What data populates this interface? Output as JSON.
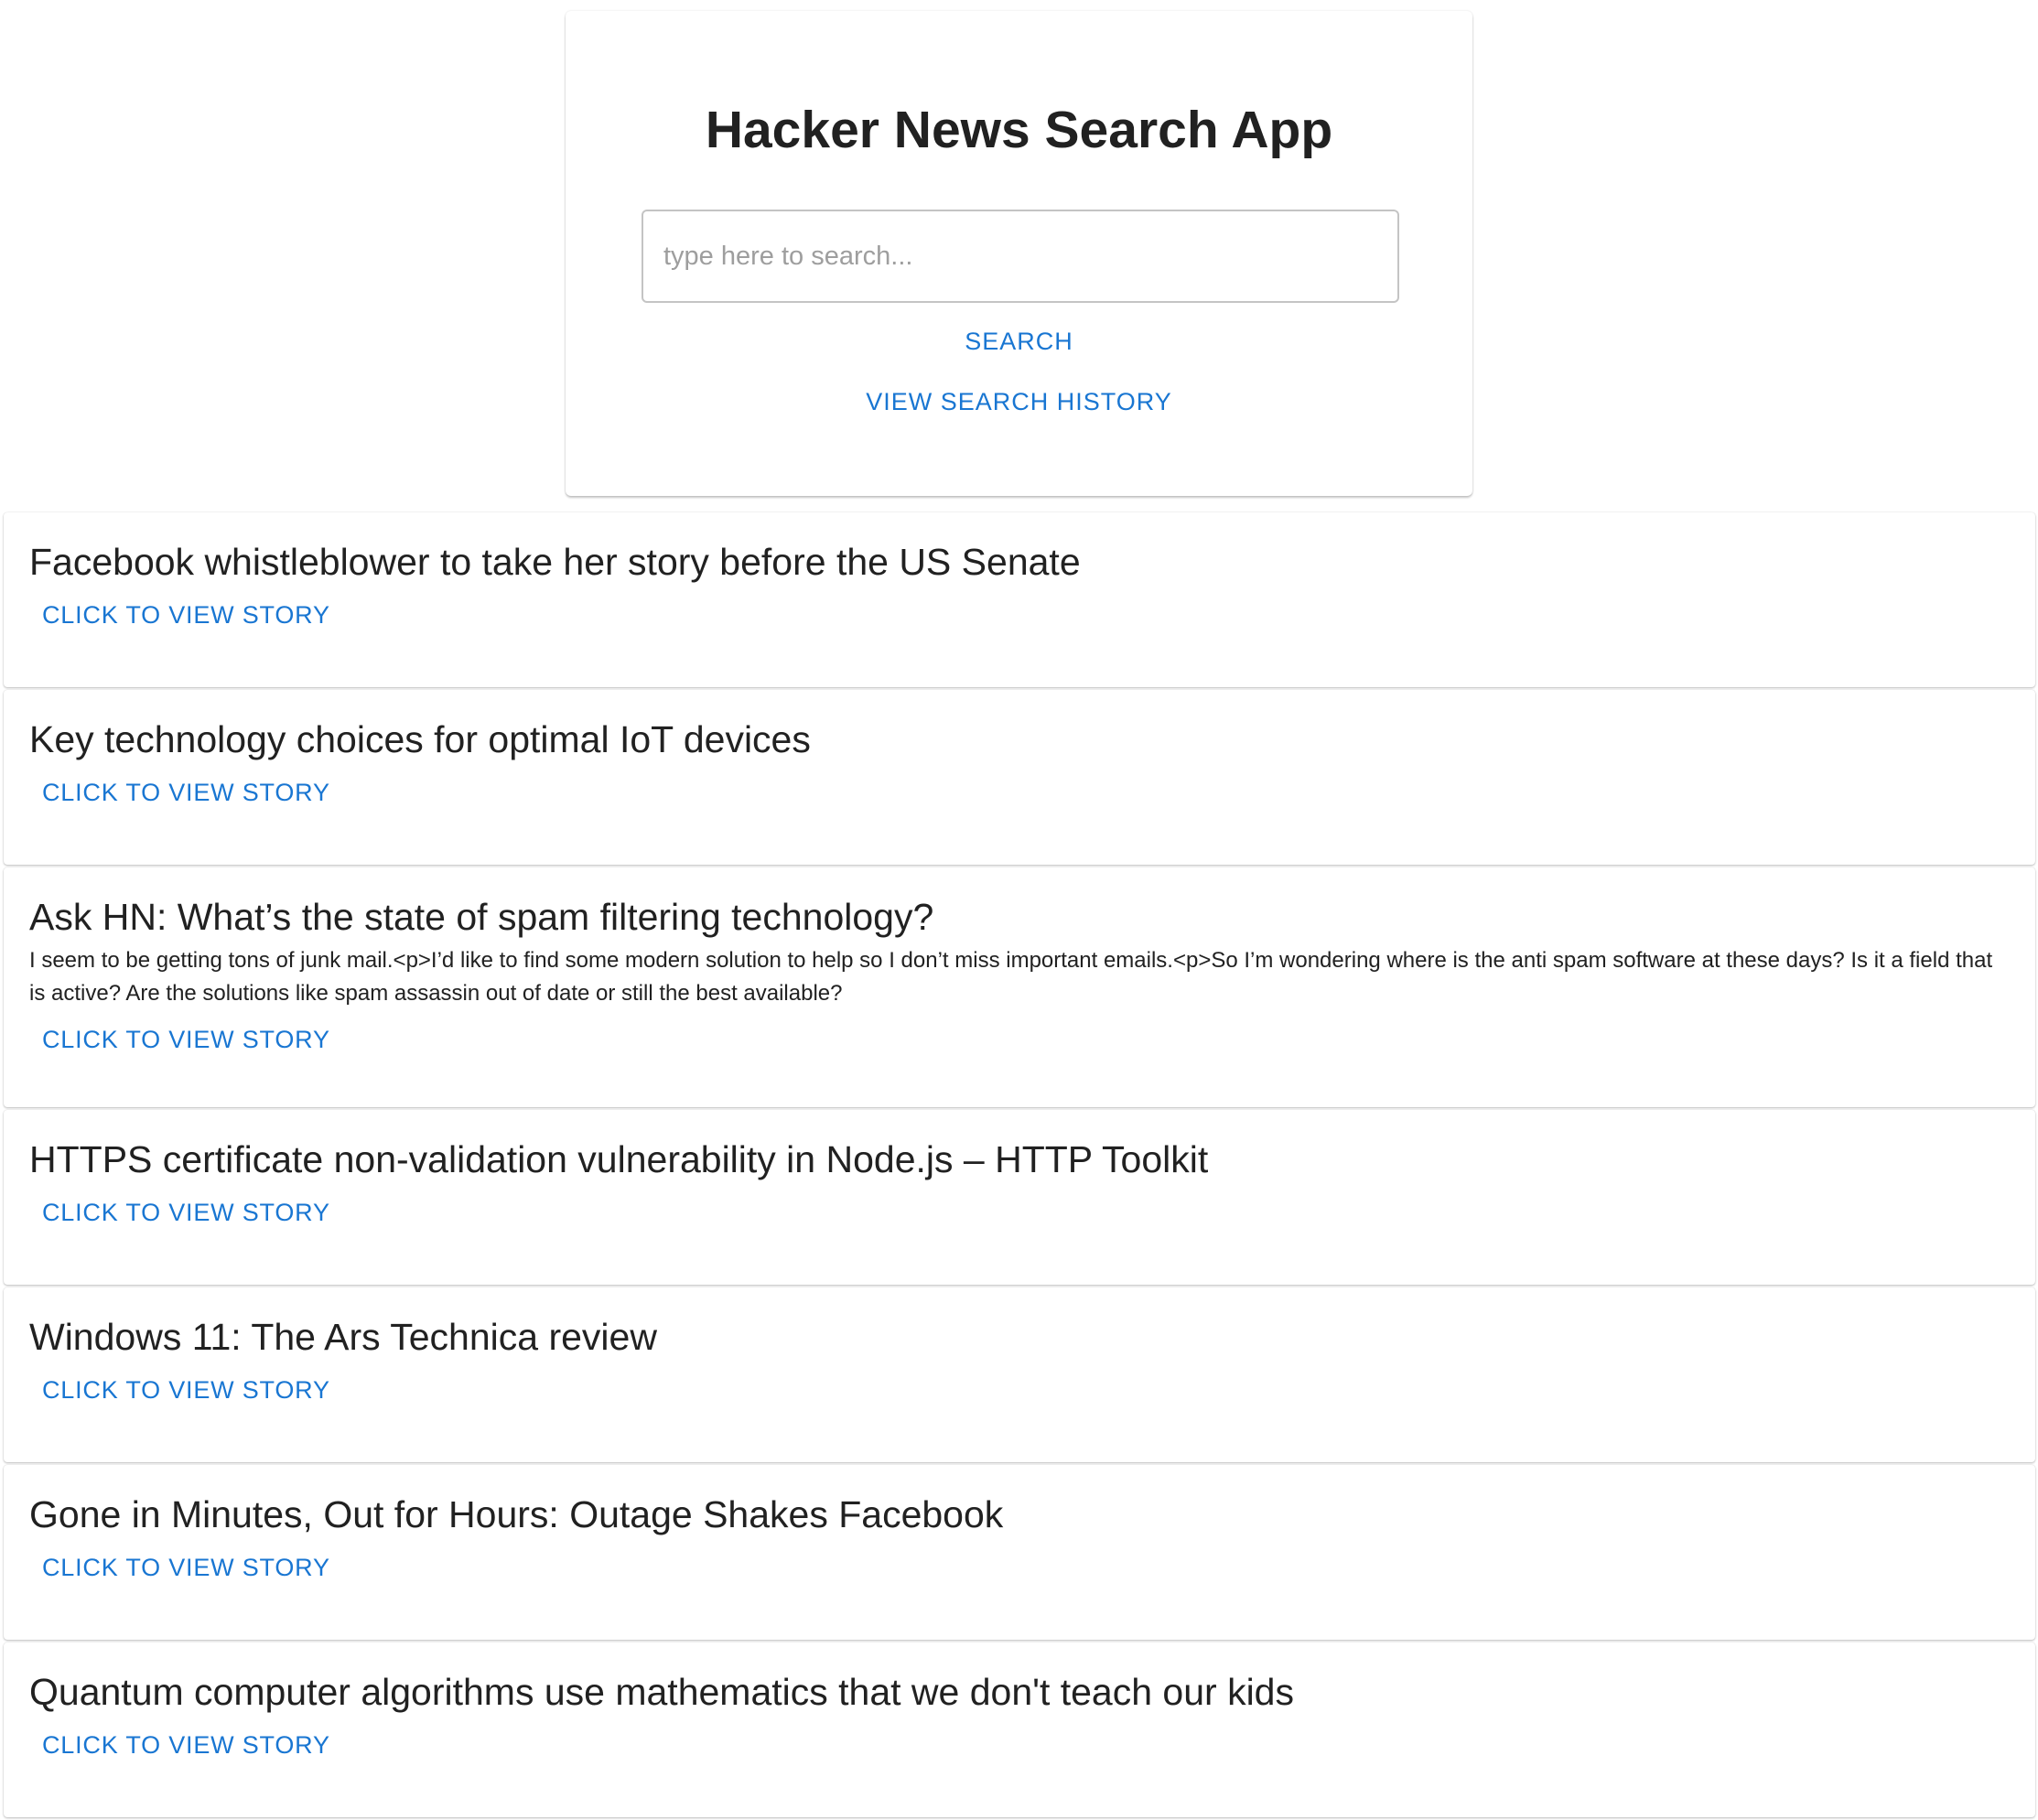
{
  "header": {
    "title": "Hacker News Search App",
    "search_placeholder": "type here to search...",
    "search_value": "",
    "search_button": "SEARCH",
    "history_button": "VIEW SEARCH HISTORY"
  },
  "stories": [
    {
      "title": "Facebook whistleblower to take her story before the US Senate",
      "text": "",
      "link_label": "CLICK TO VIEW STORY"
    },
    {
      "title": "Key technology choices for optimal IoT devices",
      "text": "",
      "link_label": "CLICK TO VIEW STORY"
    },
    {
      "title": "Ask HN: What’s the state of spam filtering technology?",
      "text": "I seem to be getting tons of junk mail.<p>I’d like to find some modern solution to help so I don’t miss important emails.<p>So I’m wondering where is the anti spam software at these days? Is it a field that is active? Are the solutions like spam assassin out of date or still the best available?",
      "link_label": "CLICK TO VIEW STORY"
    },
    {
      "title": "HTTPS certificate non-validation vulnerability in Node.js – HTTP Toolkit",
      "text": "",
      "link_label": "CLICK TO VIEW STORY"
    },
    {
      "title": "Windows 11: The Ars Technica review",
      "text": "",
      "link_label": "CLICK TO VIEW STORY"
    },
    {
      "title": "Gone in Minutes, Out for Hours: Outage Shakes Facebook",
      "text": "",
      "link_label": "CLICK TO VIEW STORY"
    },
    {
      "title": "Quantum computer algorithms use mathematics that we don't teach our kids",
      "text": "",
      "link_label": "CLICK TO VIEW STORY"
    }
  ],
  "colors": {
    "accent": "#1976d2",
    "text": "#212121",
    "placeholder": "#9e9e9e"
  }
}
